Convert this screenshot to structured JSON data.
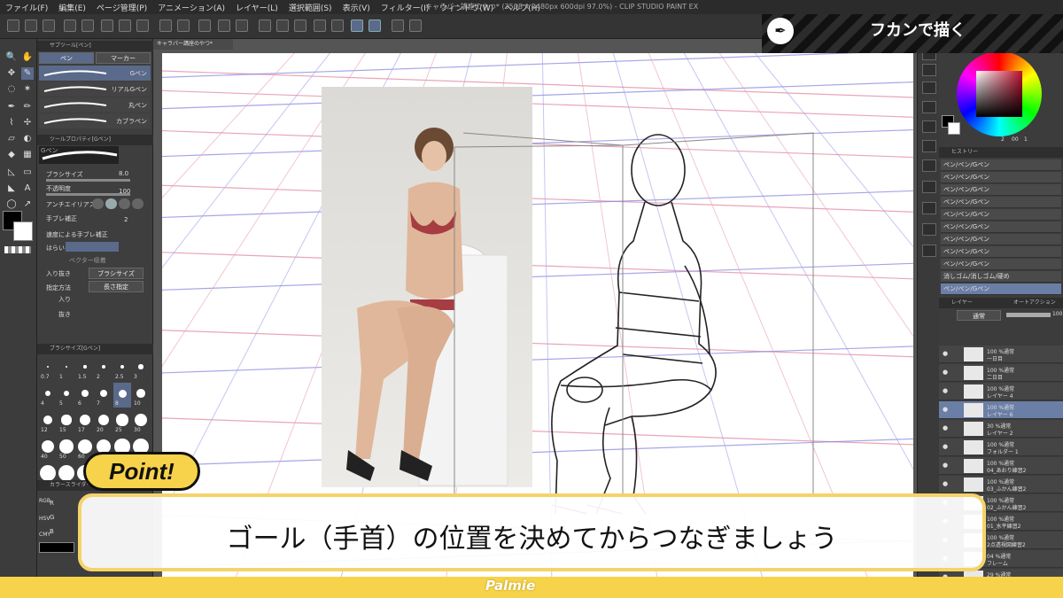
{
  "menu": [
    "ファイル(F)",
    "編集(E)",
    "ページ管理(P)",
    "アニメーション(A)",
    "レイヤー(L)",
    "選択範囲(S)",
    "表示(V)",
    "フィルター(I)",
    "ウィンドウ(W)",
    "ヘルプ(H)"
  ],
  "window_title": "キャラパー講座のやつ* (3508 x 2480px 600dpi 97.0%) - CLIP STUDIO PAINT EX",
  "doc_tab": "キャラパー講座のやつ*",
  "banner": {
    "title": "フカンで描く"
  },
  "subtool": {
    "header": "サブツール[ペン]",
    "tabs": [
      "ペン",
      "マーカー"
    ],
    "items": [
      "Gペン",
      "リアルGペン",
      "丸ペン",
      "カブラペン"
    ]
  },
  "tool_property": {
    "header": "ツールプロパティ[Gペン]",
    "preset": "Gペン",
    "brush_size_label": "ブラシサイズ",
    "brush_size_value": "8.0",
    "opacity_label": "不透明度",
    "opacity_value": "100",
    "antialias_label": "アンチエイリアス",
    "stabilization_label": "手ブレ補正",
    "stabilization_value": "2",
    "speed_stab_label": "速度による手ブレ補正",
    "taper_label": "はらい",
    "vector_label": "ベクター吸着",
    "inout_label": "入り抜き",
    "inout_value": "ブラシサイズ",
    "method_label": "指定方法",
    "method_value": "長さ指定",
    "in_label": "入り",
    "out_label": "抜き"
  },
  "brush_sizes": {
    "header": "ブラシサイズ[Gペン]",
    "values": [
      "0.7",
      "1",
      "1.5",
      "2",
      "2.5",
      "3",
      "4",
      "5",
      "6",
      "7",
      "8",
      "10",
      "12",
      "15",
      "17",
      "20",
      "25",
      "30",
      "40",
      "50",
      "60",
      "70",
      "80",
      "100",
      "120",
      "150",
      "170"
    ]
  },
  "color_panel": {
    "header": "カラースライダー",
    "labels": [
      "RGB",
      "HSV",
      "CMY"
    ],
    "channels": [
      "R",
      "G",
      "B"
    ]
  },
  "history": {
    "tab": "ヒストリー",
    "items": [
      "ペン/ペン/Gペン",
      "ペン/ペン/Gペン",
      "ペン/ペン/Gペン",
      "ペン/ペン/Gペン",
      "ペン/ペン/Gペン",
      "ペン/ペン/Gペン",
      "ペン/ペン/Gペン",
      "ペン/ペン/Gペン",
      "ペン/ペン/Gペン",
      "消しゴム/消しゴム/硬め",
      "ペン/ペン/Gペン"
    ]
  },
  "color_wheel": {
    "value1": "2",
    "value2": "00",
    "value3": "1"
  },
  "layers": {
    "tab": "レイヤー",
    "tab2": "オートアクション",
    "blend": "通常",
    "opacity": "100",
    "items": [
      {
        "l1": "100 %通常",
        "l2": "一日目"
      },
      {
        "l1": "100 %通常",
        "l2": "二日目"
      },
      {
        "l1": "100 %通常",
        "l2": "レイヤー 4"
      },
      {
        "l1": "100 %通常",
        "l2": "レイヤー 6"
      },
      {
        "l1": "30 %通常",
        "l2": "レイヤー 2"
      },
      {
        "l1": "100 %通常",
        "l2": "フォルダー 1"
      },
      {
        "l1": "100 %通常",
        "l2": "04_あおり練習2"
      },
      {
        "l1": "100 %通常",
        "l2": "03_ふかん練習2"
      },
      {
        "l1": "100 %通常",
        "l2": "02_ふかん練習2"
      },
      {
        "l1": "100 %通常",
        "l2": "01_水平練習2"
      },
      {
        "l1": "100 %通常",
        "l2": "2点透視図練習2"
      },
      {
        "l1": "04 %通常",
        "l2": "フレーム"
      },
      {
        "l1": "29 %通常",
        "l2": "あおり"
      }
    ]
  },
  "point_badge": "Point!",
  "caption": "ゴール（手首）の位置を決めてからつなぎましょう",
  "footer_logo": "Palmie",
  "colors": {
    "accent_yellow": "#f6d34b",
    "panel_dark": "#3c3c3c",
    "selection_blue": "#6b7ea6"
  }
}
